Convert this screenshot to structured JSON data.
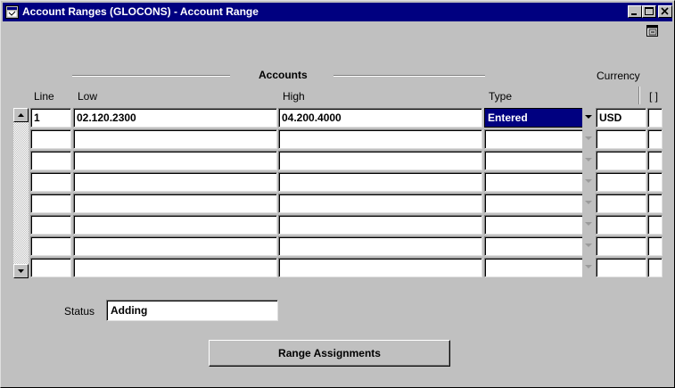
{
  "window": {
    "title": "Account Ranges (GLOCONS) - Account Range"
  },
  "icons": {
    "title_icon": "app-window-icon",
    "minimize": "minimize-icon",
    "maximize": "maximize-icon",
    "close": "close-icon",
    "help": "help-window-icon",
    "scroll_up": "arrow-up-icon",
    "scroll_down": "arrow-down-icon",
    "dropdown": "chevron-down-icon"
  },
  "colors": {
    "title_bar": "#000080",
    "selected_cell": "#000080",
    "window_bg": "#c0c0c0"
  },
  "groups": {
    "accounts": "Accounts",
    "currency": "Currency"
  },
  "columns": {
    "line": "Line",
    "low": "Low",
    "high": "High",
    "type": "Type",
    "flex": "[ ]"
  },
  "rows": [
    {
      "line": "1",
      "low": "02.120.2300",
      "high": "04.200.4000",
      "type": "Entered",
      "currency": "USD"
    },
    {
      "line": "",
      "low": "",
      "high": "",
      "type": "",
      "currency": ""
    },
    {
      "line": "",
      "low": "",
      "high": "",
      "type": "",
      "currency": ""
    },
    {
      "line": "",
      "low": "",
      "high": "",
      "type": "",
      "currency": ""
    },
    {
      "line": "",
      "low": "",
      "high": "",
      "type": "",
      "currency": ""
    },
    {
      "line": "",
      "low": "",
      "high": "",
      "type": "",
      "currency": ""
    },
    {
      "line": "",
      "low": "",
      "high": "",
      "type": "",
      "currency": ""
    },
    {
      "line": "",
      "low": "",
      "high": "",
      "type": "",
      "currency": ""
    }
  ],
  "status": {
    "label": "Status",
    "value": "Adding"
  },
  "buttons": {
    "range_assignments": "Range Assignments"
  }
}
